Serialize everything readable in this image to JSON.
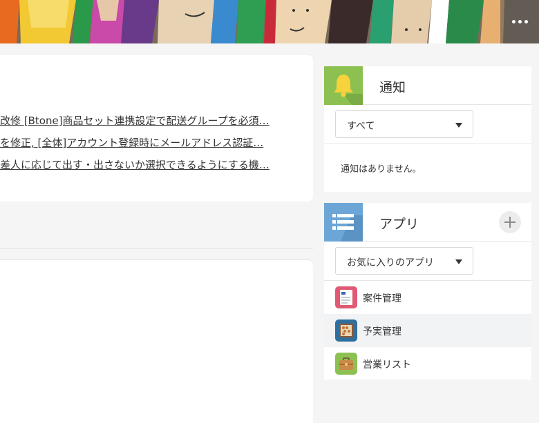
{
  "banner": {
    "more_label": "•••"
  },
  "news": {
    "links": [
      "改修 [Btone]商品セット連携設定で配送グループを必須…",
      "を修正, [全体]アカウント登録時にメールアドレス認証…",
      "差人に応じて出す・出さないか選択できるようにする機…"
    ]
  },
  "notifications": {
    "title": "通知",
    "filter_value": "すべて",
    "empty_message": "通知はありません。"
  },
  "apps": {
    "title": "アプリ",
    "filter_value": "お気に入りのアプリ",
    "items": [
      {
        "label": "案件管理",
        "icon": "document-icon",
        "color": "#e05a74"
      },
      {
        "label": "予実管理",
        "icon": "abacus-icon",
        "color": "#2f6f9e"
      },
      {
        "label": "営業リスト",
        "icon": "briefcase-icon",
        "color": "#8cc152"
      }
    ]
  },
  "colors": {
    "notify_accent": "#8cc152",
    "apps_accent": "#6ca6d6"
  }
}
